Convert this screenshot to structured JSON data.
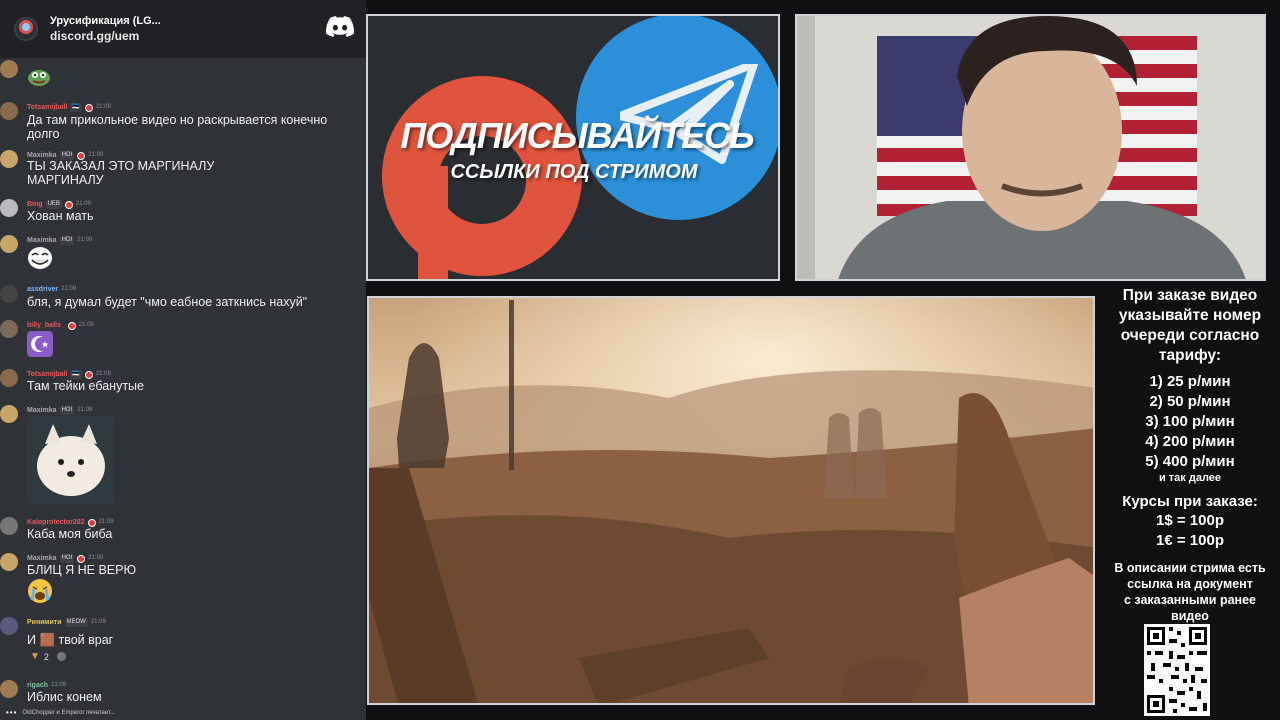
{
  "chat": {
    "server_name": "Урусификация (LG...",
    "server_link": "discord.gg/uem",
    "typing": {
      "users": "OldChopper и Emperor печатает..."
    },
    "messages": [
      {
        "id": "m0",
        "username": "",
        "time": "",
        "text": "",
        "emoji": "pepe"
      },
      {
        "id": "m1",
        "username": "Totsamijball",
        "badges": [
          "🇪🇪"
        ],
        "time": "21:09",
        "text": "Да там прикольное видео но раскрывается конечно долго"
      },
      {
        "id": "m2",
        "username": "Maximka",
        "badges": [
          "HOI"
        ],
        "time": "21:09",
        "text": "ТЫ ЗАКАЗАЛ ЭТО МАРГИНАЛУ МАРГИНАЛУ"
      },
      {
        "id": "m3",
        "username": "Bing",
        "badges": [
          "UEB"
        ],
        "time": "21:09",
        "text": "Хован мать"
      },
      {
        "id": "m4",
        "username": "Maximka",
        "badges": [
          "HOI"
        ],
        "time": "21:09",
        "text": "",
        "emoji": "trollface"
      },
      {
        "id": "m5",
        "username": "assdriver",
        "badges": [],
        "time": "21:09",
        "text": "бля, я думал будет \"чмо еабное заткнись нахуй\""
      },
      {
        "id": "m6",
        "username": "billy_balls_",
        "badges": [],
        "time": "21:09",
        "text": "",
        "emoji": "crescent"
      },
      {
        "id": "m7",
        "username": "Totsamijball",
        "badges": [
          "🇪🇪"
        ],
        "time": "21:09",
        "text": "Там тейки ебанутые"
      },
      {
        "id": "m8",
        "username": "Maximka",
        "badges": [
          "HOI"
        ],
        "time": "21:09",
        "text": "",
        "emoji": "puppy"
      },
      {
        "id": "m9",
        "username": "Kaloprotector282",
        "badges": [],
        "time": "21:09",
        "text": "Каба моя биба"
      },
      {
        "id": "m10",
        "username": "Maximka",
        "badges": [
          "HOI"
        ],
        "time": "21:09",
        "text": "БЛИЦ Я НЕ ВЕРЮ",
        "emoji": "crying"
      },
      {
        "id": "m11",
        "username": "Ринямити",
        "badges": [
          "MEOW"
        ],
        "time": "21:09",
        "text": "И 🟫 твой враг",
        "reactions": "2"
      },
      {
        "id": "m12",
        "username": "rigach",
        "badges": [],
        "time": "21:09",
        "text": "Иблис конем"
      }
    ]
  },
  "banner": {
    "title": "ПОДПИСЫВАЙТЕСЬ",
    "subtitle": "ССЫЛКИ ПОД СТРИМОМ",
    "colors": {
      "patreon": "#e0533c",
      "telegram": "#2b90d9"
    }
  },
  "info": {
    "header_lines": [
      "При заказе видео",
      "указывайте номер",
      "очереди согласно",
      "тарифу:"
    ],
    "tariffs": [
      "1) 25 р/мин",
      "2) 50 р/мин",
      "3) 100 р/мин",
      "4) 200 р/мин",
      "5) 400 р/мин"
    ],
    "tariff_note": "и так далее",
    "rates_title": "Курсы при заказе:",
    "rates": [
      "1$ = 100р",
      "1€ = 100р"
    ],
    "doc_lines": [
      "В описании стрима есть",
      "ссылка на документ",
      "с заказанными ранее",
      "видео"
    ]
  }
}
